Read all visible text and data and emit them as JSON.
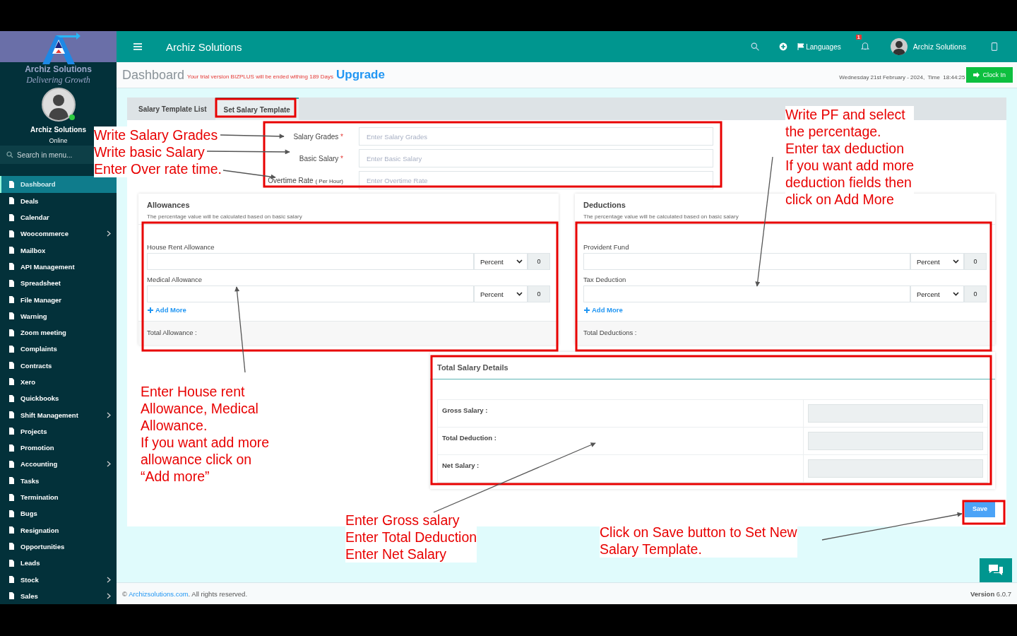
{
  "sidebar": {
    "logo_text": "Archiz Solutions",
    "logo_tagline": "Delivering Growth",
    "user_name": "Archiz Solutions",
    "user_status": "Online",
    "search_placeholder": "Search in menu...",
    "items": [
      {
        "label": "Dashboard",
        "selected": true,
        "has_submenu": false
      },
      {
        "label": "Deals",
        "selected": false,
        "has_submenu": false
      },
      {
        "label": "Calendar",
        "selected": false,
        "has_submenu": false
      },
      {
        "label": "Woocommerce",
        "selected": false,
        "has_submenu": true
      },
      {
        "label": "Mailbox",
        "selected": false,
        "has_submenu": false
      },
      {
        "label": "API Management",
        "selected": false,
        "has_submenu": false
      },
      {
        "label": "Spreadsheet",
        "selected": false,
        "has_submenu": false
      },
      {
        "label": "File Manager",
        "selected": false,
        "has_submenu": false
      },
      {
        "label": "Warning",
        "selected": false,
        "has_submenu": false
      },
      {
        "label": "Zoom meeting",
        "selected": false,
        "has_submenu": false
      },
      {
        "label": "Complaints",
        "selected": false,
        "has_submenu": false
      },
      {
        "label": "Contracts",
        "selected": false,
        "has_submenu": false
      },
      {
        "label": "Xero",
        "selected": false,
        "has_submenu": false
      },
      {
        "label": "Quickbooks",
        "selected": false,
        "has_submenu": false
      },
      {
        "label": "Shift Management",
        "selected": false,
        "has_submenu": true
      },
      {
        "label": "Projects",
        "selected": false,
        "has_submenu": false
      },
      {
        "label": "Promotion",
        "selected": false,
        "has_submenu": false
      },
      {
        "label": "Accounting",
        "selected": false,
        "has_submenu": true
      },
      {
        "label": "Tasks",
        "selected": false,
        "has_submenu": false
      },
      {
        "label": "Termination",
        "selected": false,
        "has_submenu": false
      },
      {
        "label": "Bugs",
        "selected": false,
        "has_submenu": false
      },
      {
        "label": "Resignation",
        "selected": false,
        "has_submenu": false
      },
      {
        "label": "Opportunities",
        "selected": false,
        "has_submenu": false
      },
      {
        "label": "Leads",
        "selected": false,
        "has_submenu": false
      },
      {
        "label": "Stock",
        "selected": false,
        "has_submenu": true
      },
      {
        "label": "Sales",
        "selected": false,
        "has_submenu": true
      }
    ]
  },
  "header": {
    "title": "Archiz Solutions",
    "languages": "Languages",
    "notification_count": "1",
    "user_name": "Archiz Solutions"
  },
  "subheader": {
    "title": "Dashboard",
    "trial_notice": "Your trial version BIZPLUS will be ended withing 189 Days",
    "upgrade": "Upgrade",
    "datetime": "Wednesday 21st February - 2024,  Time  18:44:25",
    "clock_in": "Clock In"
  },
  "tabs": [
    {
      "label": "Salary Template List",
      "selected": false
    },
    {
      "label": "Set Salary Template",
      "selected": true
    }
  ],
  "fields": [
    {
      "label": "Salary Grades",
      "required_mark": "*",
      "placeholder": "Enter Salary Grades"
    },
    {
      "label": "Basic Salary",
      "required_mark": "*",
      "placeholder": "Enter Basic Salary"
    },
    {
      "label": "Overtime Rate",
      "hint": "( Per Hour)",
      "placeholder": "Enter Overtime Rate"
    }
  ],
  "panels": [
    {
      "title": "Allowances",
      "note": "The percentage value will be calculated based on basic salary",
      "rows": [
        {
          "label": "House Rent Allowance",
          "type": "Percent",
          "amount": "0"
        },
        {
          "label": "Medical Allowance",
          "type": "Percent",
          "amount": "0"
        }
      ],
      "add_more": "Add More",
      "total_label": "Total Allowance :"
    },
    {
      "title": "Deductions",
      "note": "The percentage value will be calculated based on basic salary",
      "rows": [
        {
          "label": "Provident Fund",
          "type": "Percent",
          "amount": "0"
        },
        {
          "label": "Tax Deduction",
          "type": "Percent",
          "amount": "0"
        }
      ],
      "add_more": "Add More",
      "total_label": "Total Deductions :"
    }
  ],
  "totals": {
    "title": "Total Salary Details",
    "rows": [
      "Gross Salary :",
      "Total Deduction :",
      "Net Salary :"
    ]
  },
  "save": "Save",
  "footer": {
    "prefix": "© ",
    "link": "Archizsolutions.com",
    "suffix": ". All rights reserved.",
    "version": "**Version** 6.0.7"
  },
  "annotations": [
    {
      "lines": [
        "Write Salary Grades",
        "Write basic Salary",
        "Enter Over rate time."
      ]
    },
    {
      "lines": [
        "Write PF and select",
        "the percentage.",
        "Enter tax deduction",
        "If you want add more",
        "deduction fields then",
        "click on Add More"
      ]
    },
    {
      "lines": [
        "Enter House rent",
        "Allowance, Medical",
        "Allowance.",
        "If you want add more",
        "allowance click on",
        "“Add more”"
      ]
    },
    {
      "lines": [
        "Enter Gross salary",
        "Enter Total Deduction",
        "Enter Net Salary"
      ]
    },
    {
      "lines": [
        "Click on Save button to Set New",
        "Salary Template."
      ]
    }
  ]
}
